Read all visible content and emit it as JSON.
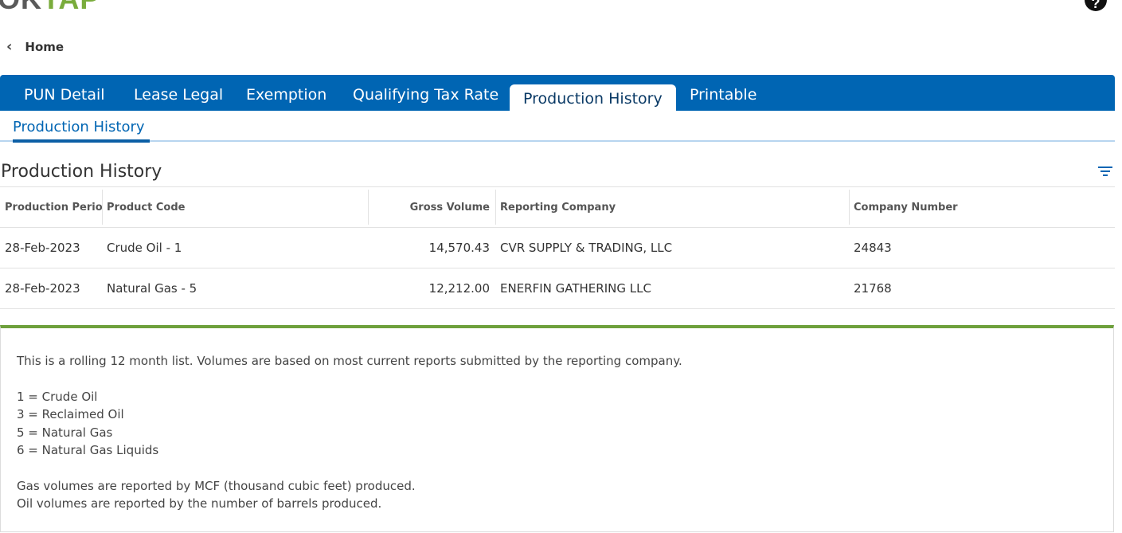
{
  "header": {
    "logo_part1": "OK",
    "logo_part2": "TAP",
    "help_icon": "question-circle-icon"
  },
  "nav": {
    "back_label": "Home",
    "back_icon": "chevron-left-icon"
  },
  "tabs": [
    {
      "label": "PUN Detail",
      "active": false
    },
    {
      "label": "Lease Legal",
      "active": false
    },
    {
      "label": "Exemption",
      "active": false
    },
    {
      "label": "Qualifying Tax Rate",
      "active": false
    },
    {
      "label": "Production History",
      "active": true
    },
    {
      "label": "Printable",
      "active": false
    }
  ],
  "subtab": {
    "label": "Production History"
  },
  "section": {
    "title": "Production History",
    "filter_icon": "filter-icon"
  },
  "table": {
    "columns": [
      "Production Period",
      "Product Code",
      "Gross Volume",
      "Reporting Company",
      "Company Number"
    ],
    "rows": [
      [
        "28-Feb-2023",
        "Crude Oil - 1",
        "14,570.43",
        "CVR SUPPLY & TRADING, LLC",
        "24843"
      ],
      [
        "28-Feb-2023",
        "Natural Gas - 5",
        "12,212.00",
        "ENERFIN GATHERING LLC",
        "21768"
      ]
    ]
  },
  "notes": {
    "intro": "This is a rolling 12 month list. Volumes are based on most current reports submitted by the reporting company.",
    "codes": [
      "1 = Crude Oil",
      "3 = Reclaimed Oil",
      "5 = Natural Gas",
      "6 = Natural Gas Liquids"
    ],
    "gas_note": "Gas volumes are reported by MCF (thousand cubic feet) produced.",
    "oil_note": "Oil volumes are reported by the number of barrels produced."
  },
  "colors": {
    "tab_bar": "#0065b3",
    "accent_green": "#6ea03c"
  }
}
